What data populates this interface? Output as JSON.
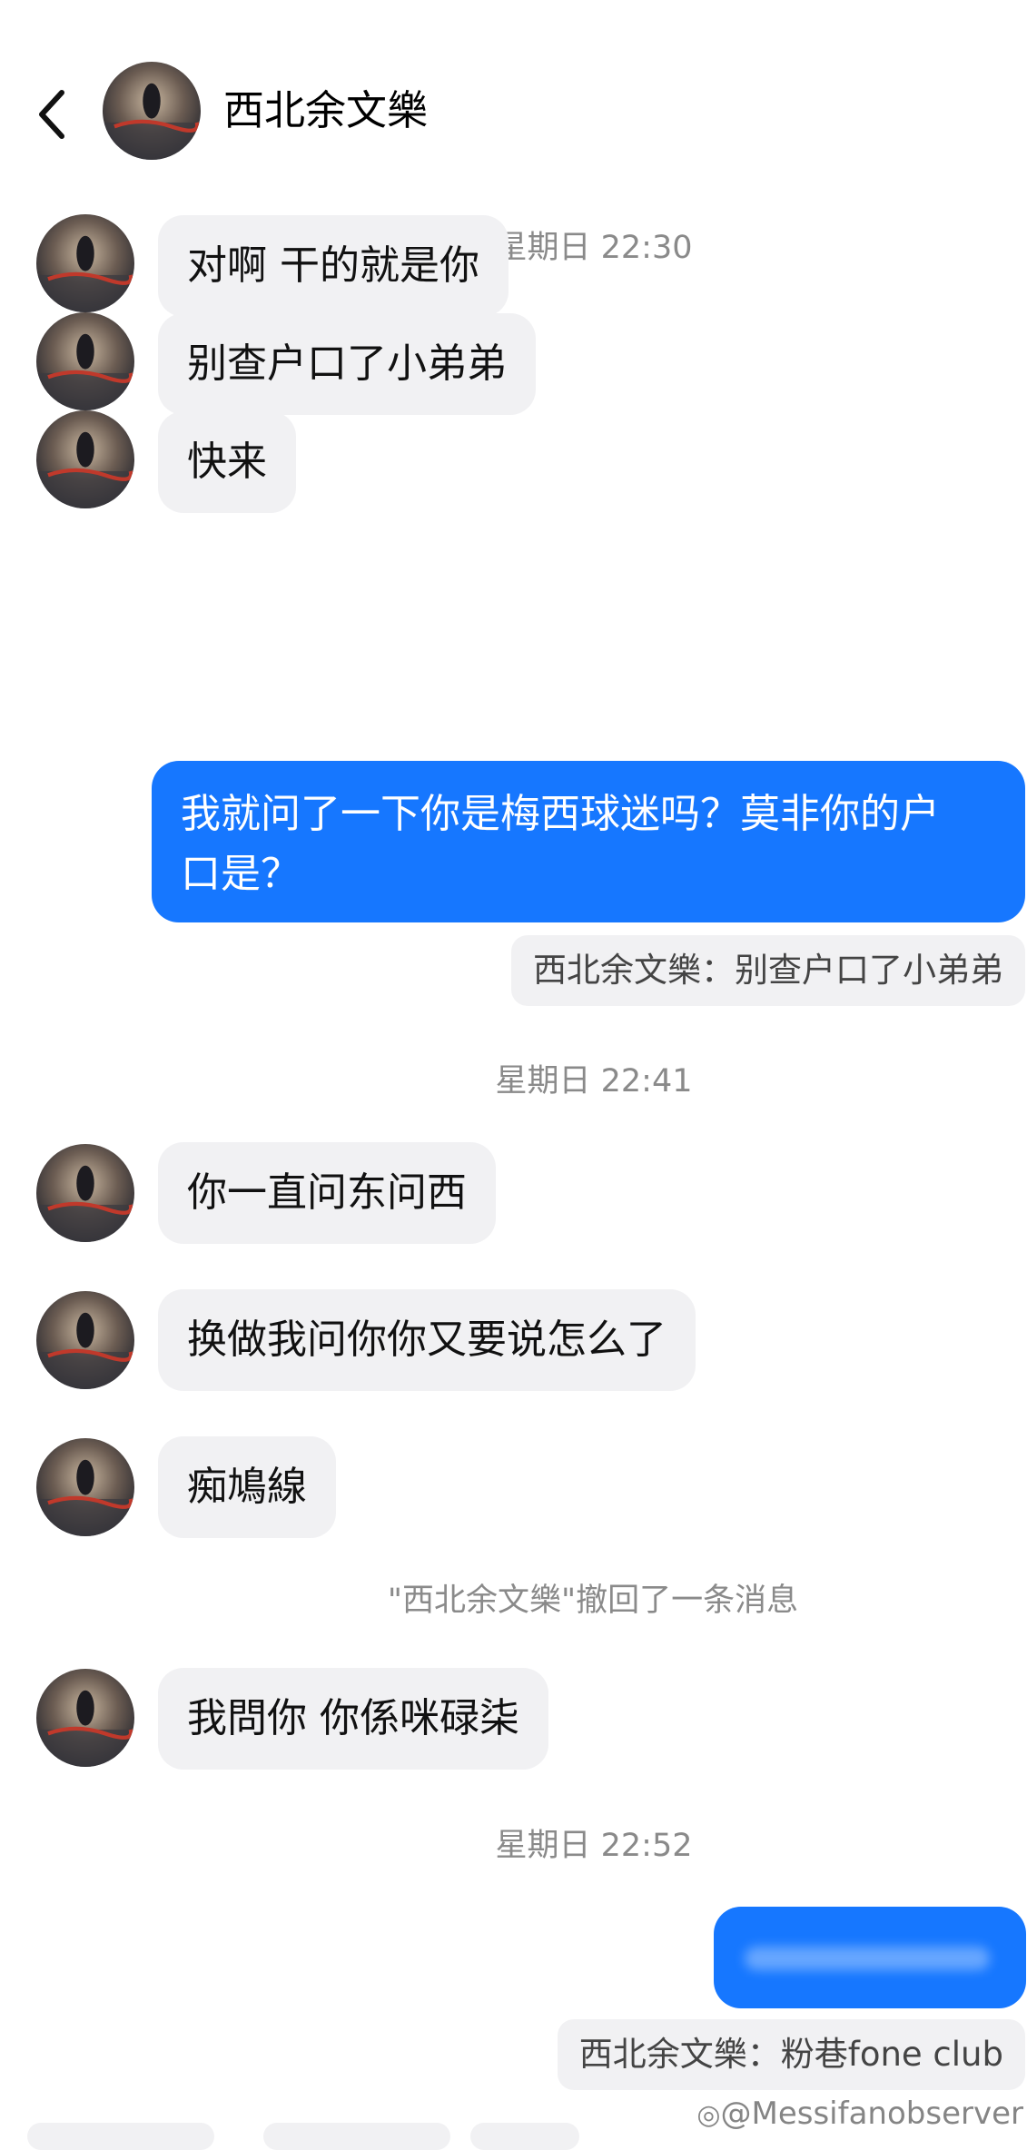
{
  "header": {
    "title": "西北余文樂",
    "back_icon": "chevron-left-icon"
  },
  "messages": [
    {
      "type": "timestamp",
      "text": "星期日 22:30"
    },
    {
      "type": "incoming",
      "text": "对啊 干的就是你"
    },
    {
      "type": "incoming",
      "text": "别查户口了小弟弟"
    },
    {
      "type": "incoming",
      "text": "快来"
    },
    {
      "type": "outgoing",
      "lines": [
        "我就问了一下你是梅西球迷吗？莫非你的户",
        "口是？"
      ],
      "quote": "西北余文樂：别查户口了小弟弟"
    },
    {
      "type": "timestamp",
      "text": "星期日 22:41"
    },
    {
      "type": "incoming",
      "text": "你一直问东问西"
    },
    {
      "type": "incoming",
      "text": "换做我问你你又要说怎么了"
    },
    {
      "type": "incoming",
      "text": "痴鳩線"
    },
    {
      "type": "system",
      "text": "\"西北余文樂\"撤回了一条消息"
    },
    {
      "type": "incoming",
      "text": "我問你 你係咪碌柒"
    },
    {
      "type": "timestamp",
      "text": "星期日 22:52"
    },
    {
      "type": "outgoing-blurred",
      "quote": "西北余文樂：粉巷fone club"
    }
  ],
  "watermark": "@Messifanobserver",
  "colors": {
    "outgoing_bubble": "#1677ff",
    "incoming_bubble": "#f1f1f3",
    "timestamp": "#8a8a8a"
  }
}
